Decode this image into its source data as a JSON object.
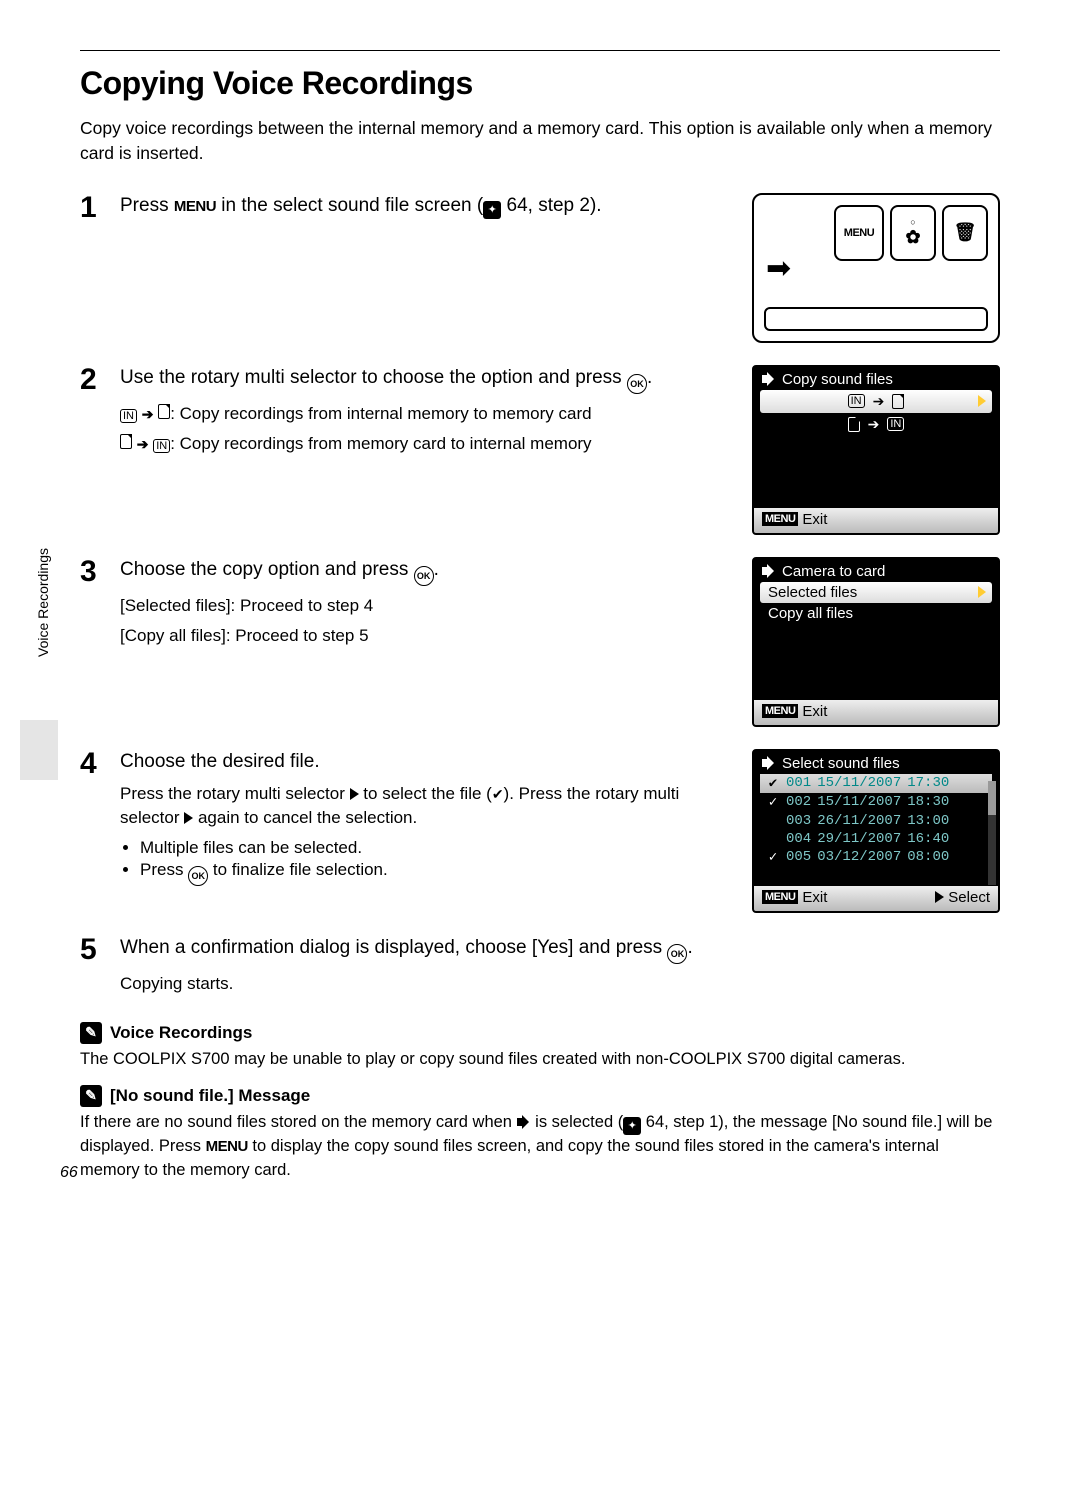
{
  "page_number": "66",
  "side_label": "Voice Recordings",
  "title": "Copying Voice Recordings",
  "intro": "Copy voice recordings between the internal memory and a memory card. This option is available only when a memory card is inserted.",
  "steps": {
    "s1": {
      "num": "1",
      "main_a": "Press ",
      "main_menu": "MENU",
      "main_b": " in the select sound file screen (",
      "main_ref": " 64, step 2).",
      "camera_menu": "MENU"
    },
    "s2": {
      "num": "2",
      "main_a": "Use the rotary multi selector to choose the option and press ",
      "main_ok": "OK",
      "main_b": ".",
      "sub1": ": Copy recordings from internal memory to memory card",
      "sub2": ": Copy recordings from memory card to internal memory",
      "lcd_title": "Copy sound files",
      "lcd_exit": "Exit"
    },
    "s3": {
      "num": "3",
      "main_a": "Choose the copy option and press ",
      "main_ok": "OK",
      "main_b": ".",
      "sub1": "[Selected files]: Proceed to step 4",
      "sub2": "[Copy all files]: Proceed to step 5",
      "lcd_title": "Camera to card",
      "lcd_opt1": "Selected files",
      "lcd_opt2": "Copy all files",
      "lcd_exit": "Exit"
    },
    "s4": {
      "num": "4",
      "main": "Choose the desired file.",
      "sub_a": "Press the rotary multi selector ",
      "sub_b": " to select the file (",
      "sub_c": "). Press the rotary multi selector ",
      "sub_d": " again to cancel the selection.",
      "bullet1": "Multiple files can be selected.",
      "bullet2_a": "Press ",
      "bullet2_ok": "OK",
      "bullet2_b": " to finalize file selection.",
      "lcd_title": "Select sound files",
      "files": [
        {
          "chk": "✔",
          "n": "001",
          "d": "15/11/2007",
          "t": "17:30"
        },
        {
          "chk": "✓",
          "n": "002",
          "d": "15/11/2007",
          "t": "18:30"
        },
        {
          "chk": "",
          "n": "003",
          "d": "26/11/2007",
          "t": "13:00"
        },
        {
          "chk": "",
          "n": "004",
          "d": "29/11/2007",
          "t": "16:40"
        },
        {
          "chk": "✓",
          "n": "005",
          "d": "03/12/2007",
          "t": "08:00"
        }
      ],
      "lcd_exit": "Exit",
      "lcd_select": "Select"
    },
    "s5": {
      "num": "5",
      "main_a": "When a confirmation dialog is displayed, choose [Yes] and press ",
      "main_ok": "OK",
      "main_b": ".",
      "sub": "Copying starts."
    }
  },
  "notes": {
    "n1": {
      "head": "Voice Recordings",
      "body": "The COOLPIX S700 may be unable to play or copy sound files created with non-COOLPIX S700 digital cameras."
    },
    "n2": {
      "head": "[No sound file.] Message",
      "body_a": "If there are no sound files stored on the memory card when ",
      "body_b": " is selected (",
      "body_c": " 64, step 1), the message [No sound file.] will be displayed. Press ",
      "body_menu": "MENU",
      "body_d": " to display the copy sound files screen, and copy the sound files stored in the camera's internal memory to the memory card."
    }
  }
}
